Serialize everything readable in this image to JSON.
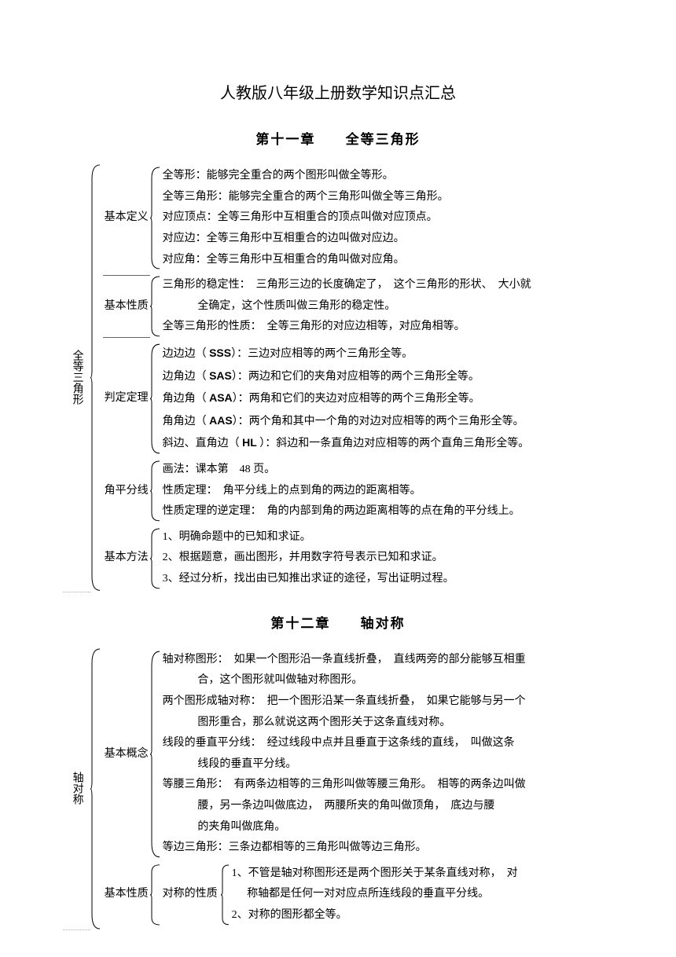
{
  "main_title": "人教版八年级上册数学知识点汇总",
  "ch11": {
    "chapter_num": "第十一章",
    "chapter_name": "全等三角形",
    "root_label": "全等三角形",
    "s1": {
      "label": "基本定义",
      "l1": "全等形：能够完全重合的两个图形叫做全等形。",
      "l2": "全等三角形：能够完全重合的两个三角形叫做全等三角形。",
      "l3": "对应顶点：全等三角形中互相重合的顶点叫做对应顶点。",
      "l4": "对应边：全等三角形中互相重合的边叫做对应边。",
      "l5": "对应角：全等三角形中互相重合的角叫做对应角。"
    },
    "s2": {
      "label": "基本性质",
      "l1a": "三角形的稳定性：　三角形三边的长度确定了，　这个三角形的形状、　大小就",
      "l1b": "全确定，这个性质叫做三角形的稳定性。",
      "l2": "全等三角形的性质：　全等三角形的对应边相等，对应角相等。"
    },
    "s3": {
      "label": "判定定理",
      "l1a": "边边边（ ",
      "l1b": "SSS",
      "l1c": "）：三边对应相等的两个三角形全等。",
      "l2a": "边角边（ ",
      "l2b": "SAS",
      "l2c": "）：两边和它们的夹角对应相等的两个三角形全等。",
      "l3a": "角边角（ ",
      "l3b": "ASA",
      "l3c": "）：两角和它们的夹边对应相等的两个三角形全等。",
      "l4a": "角角边（ ",
      "l4b": "AAS",
      "l4c": "）：两个角和其中一个角的对边对应相等的两个三角形全等。",
      "l5a": "斜边、直角边（ ",
      "l5b": "HL",
      "l5c": " ）：斜边和一条直角边对应相等的两个直角三角形全等。"
    },
    "s4": {
      "label": "角平分线",
      "l1": "画法：课本第　48 页。",
      "l2": "性质定理：　角平分线上的点到角的两边的距离相等。",
      "l3": "性质定理的逆定理：　角的内部到角的两边距离相等的点在角的平分线上。"
    },
    "s5": {
      "label": "基本方法",
      "l1": "1、明确命题中的已知和求证。",
      "l2": "2、根据题意，画出图形，并用数字符号表示已知和求证。",
      "l3": "3、经过分析，找出由已知推出求证的途径，写出证明过程。"
    }
  },
  "ch12": {
    "chapter_num": "第十二章",
    "chapter_name": "轴对称",
    "root_label": "轴对称",
    "s1": {
      "label": "基本概念",
      "l1a": "轴对称图形：　如果一个图形沿一条直线折叠，　直线两旁的部分能够互相重",
      "l1b": "合，这个图形就叫做轴对称图形。",
      "l2a": "两个图形成轴对称：　把一个图形沿某一条直线折叠，　如果它能够与另一个",
      "l2b": "图形重合，那么就说这两个图形关于这条直线对称。",
      "l3a": "线段的垂直平分线：　经过线段中点并且垂直于这条线的直线，　叫做这条",
      "l3b": "线段的垂直平分线。",
      "l4a": "等腰三角形：　有两条边相等的三角形叫做等腰三角形。　相等的两条边叫做",
      "l4b": "腰，另一条边叫做底边，　两腰所夹的角叫做顶角，　底边与腰",
      "l4c": "的夹角叫做底角。",
      "l5": "等边三角形：三条边都相等的三角形叫做等边三角形。"
    },
    "s2": {
      "label": "基本性质",
      "sub1_label": "对称的性质",
      "sub1_l1a": "1、不管是轴对称图形还是两个图形关于某条直线对称，　对",
      "sub1_l1b": "称轴都是任何一对对应点所连线段的垂直平分线。",
      "sub1_l2": "2、对称的图形都全等。"
    }
  }
}
